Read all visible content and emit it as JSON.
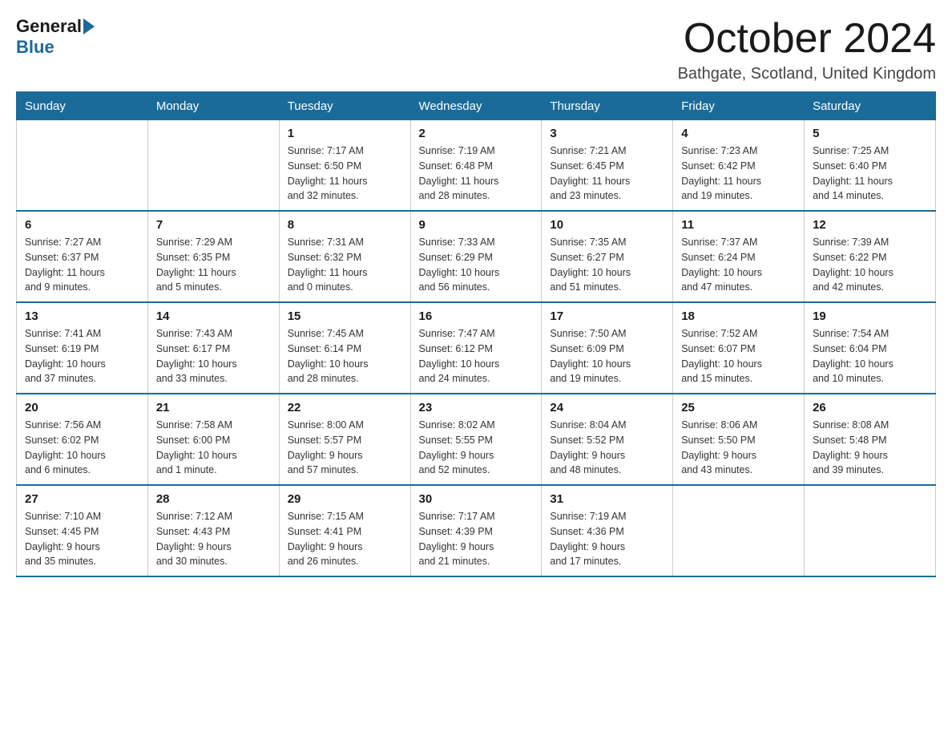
{
  "header": {
    "logo_general": "General",
    "logo_blue": "Blue",
    "month_title": "October 2024",
    "location": "Bathgate, Scotland, United Kingdom"
  },
  "days_of_week": [
    "Sunday",
    "Monday",
    "Tuesday",
    "Wednesday",
    "Thursday",
    "Friday",
    "Saturday"
  ],
  "weeks": [
    [
      {
        "day": "",
        "info": ""
      },
      {
        "day": "",
        "info": ""
      },
      {
        "day": "1",
        "info": "Sunrise: 7:17 AM\nSunset: 6:50 PM\nDaylight: 11 hours\nand 32 minutes."
      },
      {
        "day": "2",
        "info": "Sunrise: 7:19 AM\nSunset: 6:48 PM\nDaylight: 11 hours\nand 28 minutes."
      },
      {
        "day": "3",
        "info": "Sunrise: 7:21 AM\nSunset: 6:45 PM\nDaylight: 11 hours\nand 23 minutes."
      },
      {
        "day": "4",
        "info": "Sunrise: 7:23 AM\nSunset: 6:42 PM\nDaylight: 11 hours\nand 19 minutes."
      },
      {
        "day": "5",
        "info": "Sunrise: 7:25 AM\nSunset: 6:40 PM\nDaylight: 11 hours\nand 14 minutes."
      }
    ],
    [
      {
        "day": "6",
        "info": "Sunrise: 7:27 AM\nSunset: 6:37 PM\nDaylight: 11 hours\nand 9 minutes."
      },
      {
        "day": "7",
        "info": "Sunrise: 7:29 AM\nSunset: 6:35 PM\nDaylight: 11 hours\nand 5 minutes."
      },
      {
        "day": "8",
        "info": "Sunrise: 7:31 AM\nSunset: 6:32 PM\nDaylight: 11 hours\nand 0 minutes."
      },
      {
        "day": "9",
        "info": "Sunrise: 7:33 AM\nSunset: 6:29 PM\nDaylight: 10 hours\nand 56 minutes."
      },
      {
        "day": "10",
        "info": "Sunrise: 7:35 AM\nSunset: 6:27 PM\nDaylight: 10 hours\nand 51 minutes."
      },
      {
        "day": "11",
        "info": "Sunrise: 7:37 AM\nSunset: 6:24 PM\nDaylight: 10 hours\nand 47 minutes."
      },
      {
        "day": "12",
        "info": "Sunrise: 7:39 AM\nSunset: 6:22 PM\nDaylight: 10 hours\nand 42 minutes."
      }
    ],
    [
      {
        "day": "13",
        "info": "Sunrise: 7:41 AM\nSunset: 6:19 PM\nDaylight: 10 hours\nand 37 minutes."
      },
      {
        "day": "14",
        "info": "Sunrise: 7:43 AM\nSunset: 6:17 PM\nDaylight: 10 hours\nand 33 minutes."
      },
      {
        "day": "15",
        "info": "Sunrise: 7:45 AM\nSunset: 6:14 PM\nDaylight: 10 hours\nand 28 minutes."
      },
      {
        "day": "16",
        "info": "Sunrise: 7:47 AM\nSunset: 6:12 PM\nDaylight: 10 hours\nand 24 minutes."
      },
      {
        "day": "17",
        "info": "Sunrise: 7:50 AM\nSunset: 6:09 PM\nDaylight: 10 hours\nand 19 minutes."
      },
      {
        "day": "18",
        "info": "Sunrise: 7:52 AM\nSunset: 6:07 PM\nDaylight: 10 hours\nand 15 minutes."
      },
      {
        "day": "19",
        "info": "Sunrise: 7:54 AM\nSunset: 6:04 PM\nDaylight: 10 hours\nand 10 minutes."
      }
    ],
    [
      {
        "day": "20",
        "info": "Sunrise: 7:56 AM\nSunset: 6:02 PM\nDaylight: 10 hours\nand 6 minutes."
      },
      {
        "day": "21",
        "info": "Sunrise: 7:58 AM\nSunset: 6:00 PM\nDaylight: 10 hours\nand 1 minute."
      },
      {
        "day": "22",
        "info": "Sunrise: 8:00 AM\nSunset: 5:57 PM\nDaylight: 9 hours\nand 57 minutes."
      },
      {
        "day": "23",
        "info": "Sunrise: 8:02 AM\nSunset: 5:55 PM\nDaylight: 9 hours\nand 52 minutes."
      },
      {
        "day": "24",
        "info": "Sunrise: 8:04 AM\nSunset: 5:52 PM\nDaylight: 9 hours\nand 48 minutes."
      },
      {
        "day": "25",
        "info": "Sunrise: 8:06 AM\nSunset: 5:50 PM\nDaylight: 9 hours\nand 43 minutes."
      },
      {
        "day": "26",
        "info": "Sunrise: 8:08 AM\nSunset: 5:48 PM\nDaylight: 9 hours\nand 39 minutes."
      }
    ],
    [
      {
        "day": "27",
        "info": "Sunrise: 7:10 AM\nSunset: 4:45 PM\nDaylight: 9 hours\nand 35 minutes."
      },
      {
        "day": "28",
        "info": "Sunrise: 7:12 AM\nSunset: 4:43 PM\nDaylight: 9 hours\nand 30 minutes."
      },
      {
        "day": "29",
        "info": "Sunrise: 7:15 AM\nSunset: 4:41 PM\nDaylight: 9 hours\nand 26 minutes."
      },
      {
        "day": "30",
        "info": "Sunrise: 7:17 AM\nSunset: 4:39 PM\nDaylight: 9 hours\nand 21 minutes."
      },
      {
        "day": "31",
        "info": "Sunrise: 7:19 AM\nSunset: 4:36 PM\nDaylight: 9 hours\nand 17 minutes."
      },
      {
        "day": "",
        "info": ""
      },
      {
        "day": "",
        "info": ""
      }
    ]
  ]
}
